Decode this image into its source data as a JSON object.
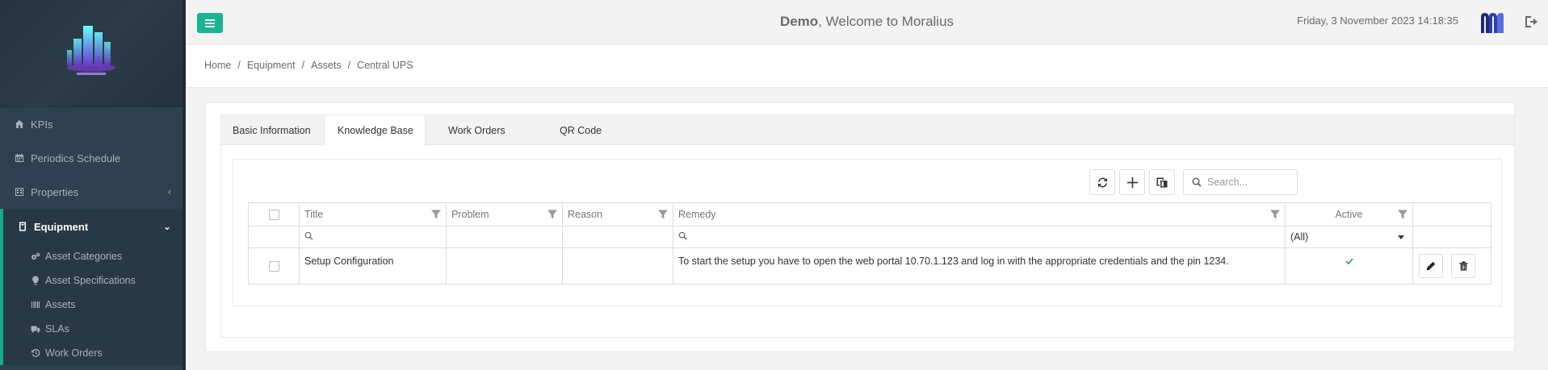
{
  "header": {
    "user": "Demo",
    "welcome_suffix": ", Welcome to Moralius",
    "datetime": "Friday, 3 November 2023 14:18:35"
  },
  "sidebar": {
    "items": [
      {
        "label": "KPIs",
        "icon": "home-icon"
      },
      {
        "label": "Periodics Schedule",
        "icon": "calendar-icon"
      },
      {
        "label": "Properties",
        "icon": "building-icon"
      },
      {
        "label": "Equipment",
        "icon": "equipment-icon"
      }
    ],
    "subitems": [
      {
        "label": "Asset Categories",
        "icon": "cogs-icon"
      },
      {
        "label": "Asset Specifications",
        "icon": "lightbulb-icon"
      },
      {
        "label": "Assets",
        "icon": "barcode-icon"
      },
      {
        "label": "SLAs",
        "icon": "truck-icon"
      },
      {
        "label": "Work Orders",
        "icon": "history-icon"
      }
    ]
  },
  "breadcrumb": [
    "Home",
    "Equipment",
    "Assets",
    "Central UPS"
  ],
  "tabs": [
    {
      "label": "Basic Information",
      "active": false
    },
    {
      "label": "Knowledge Base",
      "active": true
    },
    {
      "label": "Work Orders",
      "active": false
    },
    {
      "label": "QR Code",
      "active": false
    }
  ],
  "grid": {
    "search_placeholder": "Search...",
    "columns": [
      "Title",
      "Problem",
      "Reason",
      "Remedy",
      "Active"
    ],
    "active_filter": "(All)",
    "rows": [
      {
        "title": "Setup Configuration",
        "problem": "",
        "reason": "",
        "remedy": "To start the setup you have to open the web portal 10.70.1.123 and log in with the appropriate credentials and the pin 1234.",
        "active": true
      }
    ]
  },
  "colors": {
    "accent": "#1ab394",
    "sidebar": "#2f4050",
    "sidebar_active": "#293846"
  }
}
